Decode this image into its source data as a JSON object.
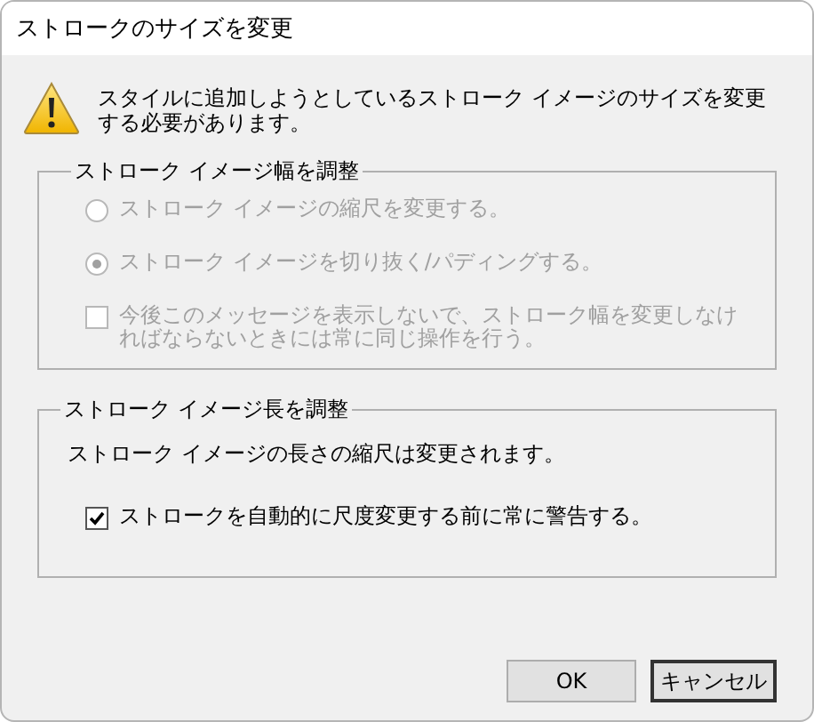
{
  "window": {
    "title": "ストロークのサイズを変更"
  },
  "message": "スタイルに追加しようとしているストローク イメージのサイズを変更する必要があります。",
  "width_group": {
    "title": "ストローク イメージ幅を調整",
    "disabled": true,
    "options": [
      {
        "kind": "radio",
        "label": "ストローク イメージの縮尺を変更する。",
        "selected": false
      },
      {
        "kind": "radio",
        "label": "ストローク イメージを切り抜く/パディングする。",
        "selected": true
      },
      {
        "kind": "checkbox",
        "label": "今後このメッセージを表示しないで、ストローク幅を変更しなければならないときには常に同じ操作を行う。",
        "checked": false
      }
    ]
  },
  "length_group": {
    "title": "ストローク イメージ長を調整",
    "disabled": false,
    "note": "ストローク イメージの長さの縮尺は変更されます。",
    "options": [
      {
        "kind": "checkbox",
        "label": "ストロークを自動的に尺度変更する前に常に警告する。",
        "checked": true
      }
    ]
  },
  "buttons": [
    {
      "label": "OK",
      "default": false
    },
    {
      "label": "キャンセル",
      "default": true
    }
  ]
}
